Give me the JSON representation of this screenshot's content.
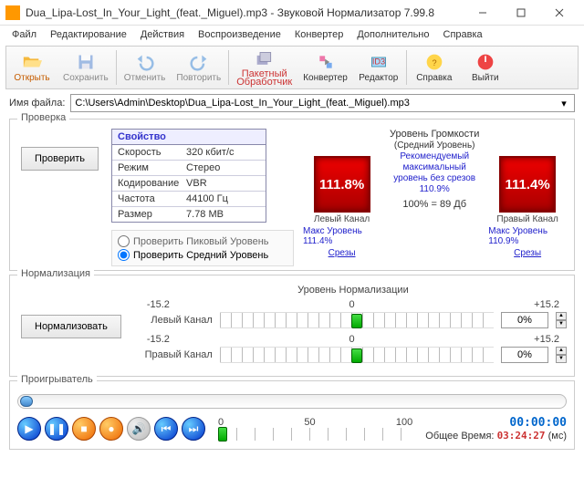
{
  "window": {
    "title": "Dua_Lipa-Lost_In_Your_Light_(feat._Miguel).mp3 - Звуковой Нормализатор 7.99.8"
  },
  "menu": {
    "file": "Файл",
    "edit": "Редактирование",
    "actions": "Действия",
    "playback": "Воспроизведение",
    "converter": "Конвертер",
    "extra": "Дополнительно",
    "help": "Справка"
  },
  "toolbar": {
    "open": "Открыть",
    "save": "Сохранить",
    "undo": "Отменить",
    "redo": "Повторить",
    "batch1": "Пакетный",
    "batch2": "Обработчик",
    "converter": "Конвертер",
    "editor": "Редактор",
    "helptb": "Справка",
    "exit": "Выйти"
  },
  "fileRow": {
    "label": "Имя файла:",
    "value": "C:\\Users\\Admin\\Desktop\\Dua_Lipa-Lost_In_Your_Light_(feat._Miguel).mp3"
  },
  "check": {
    "group": "Проверка",
    "button": "Проверить",
    "propHeader": "Свойство",
    "props": {
      "speed_k": "Скорость",
      "speed_v": "320 кбит/с",
      "mode_k": "Режим",
      "mode_v": "Стерео",
      "enc_k": "Кодирование",
      "enc_v": "VBR",
      "freq_k": "Частота",
      "freq_v": "44100 Гц",
      "size_k": "Размер",
      "size_v": "7.78 МВ"
    },
    "radioPeak": "Проверить Пиковый Уровень",
    "radioAvg": "Проверить Средний Уровень",
    "volTitle1": "Уровень Громкости",
    "volTitle2": "(Средний Уровень)",
    "rec1": "Рекомендуемый",
    "rec2": "максимальный",
    "rec3": "уровень без срезов",
    "rec4": "110.9%",
    "leftVal": "111.8%",
    "rightVal": "111.4%",
    "leftCap": "Левый Канал",
    "rightCap": "Правый Канал",
    "eq": "100% = 89 Дб",
    "leftMax": "Макс Уровень 111.4%",
    "rightMax": "Макс Уровень 110.9%",
    "clips": "Срезы"
  },
  "norm": {
    "group": "Нормализация",
    "button": "Нормализовать",
    "title": "Уровень Нормализации",
    "min": "-15.2",
    "mid": "0",
    "max": "+15.2",
    "left": "Левый Канал",
    "right": "Правый Канал",
    "leftPct": "0%",
    "rightPct": "0%"
  },
  "player": {
    "group": "Проигрыватель",
    "t0": "0",
    "t50": "50",
    "t100": "100",
    "cur": "00:00:00",
    "totalLabel": "Общее Время:",
    "total": "03:24:27",
    "ms": "(мс)"
  }
}
